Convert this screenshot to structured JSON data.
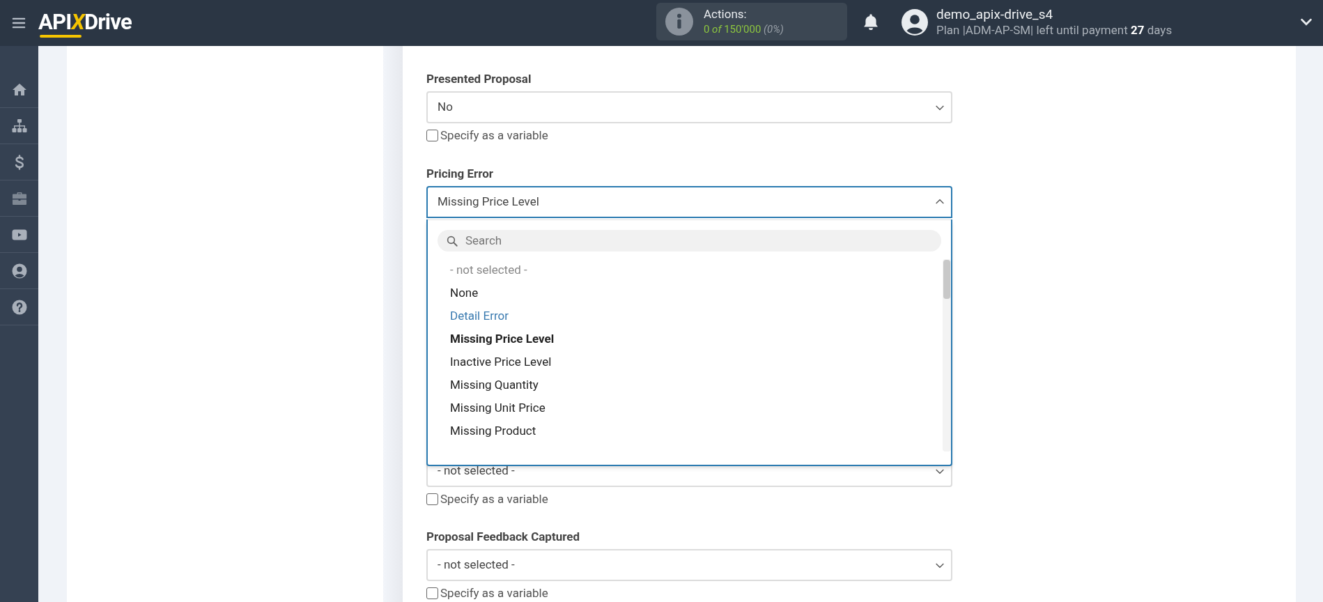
{
  "header": {
    "logo": [
      {
        "text": "API",
        "kind": "plain"
      },
      {
        "text": "X",
        "kind": "accent"
      },
      {
        "text": "Drive",
        "kind": "plain"
      }
    ],
    "actions": {
      "label": "Actions:",
      "used": "0",
      "of": "of",
      "total": "150'000",
      "percent": "(0%)"
    },
    "user": {
      "name": "demo_apix-drive_s4",
      "plan": "Plan |ADM-AP-SM| left until payment **27** days"
    }
  },
  "sidebar": {
    "items": [
      {
        "kind": "home"
      },
      {
        "kind": "sitemap"
      },
      {
        "kind": "dollar"
      },
      {
        "kind": "briefcase"
      },
      {
        "kind": "video"
      },
      {
        "kind": "user"
      },
      {
        "kind": "help"
      }
    ]
  },
  "fields": [
    {
      "label": "Presented Proposal",
      "value": "No",
      "open": false,
      "variable": {
        "label": "Specify as a variable",
        "checked": false
      }
    },
    {
      "label": "Pricing Error",
      "value": "Missing Price Level",
      "open": true,
      "search_placeholder": "Search",
      "options": [
        {
          "text": "- not selected -",
          "kind": "placeholder",
          "selected": false,
          "highlighted": false
        },
        {
          "text": "None",
          "kind": "option",
          "selected": false,
          "highlighted": false
        },
        {
          "text": "Detail Error",
          "kind": "option",
          "selected": false,
          "highlighted": true
        },
        {
          "text": "Missing Price Level",
          "kind": "option",
          "selected": true,
          "highlighted": false
        },
        {
          "text": "Inactive Price Level",
          "kind": "option",
          "selected": false,
          "highlighted": false
        },
        {
          "text": "Missing Quantity",
          "kind": "option",
          "selected": false,
          "highlighted": false
        },
        {
          "text": "Missing Unit Price",
          "kind": "option",
          "selected": false,
          "highlighted": false
        },
        {
          "text": "Missing Product",
          "kind": "option",
          "selected": false,
          "highlighted": false
        }
      ]
    },
    {
      "value": "- not selected -",
      "open": false,
      "variable": {
        "label": "Specify as a variable",
        "checked": false
      }
    },
    {
      "label": "Proposal Feedback Captured",
      "value": "- not selected -",
      "open": false,
      "variable": {
        "label": "Specify as a variable",
        "checked": false
      }
    }
  ]
}
